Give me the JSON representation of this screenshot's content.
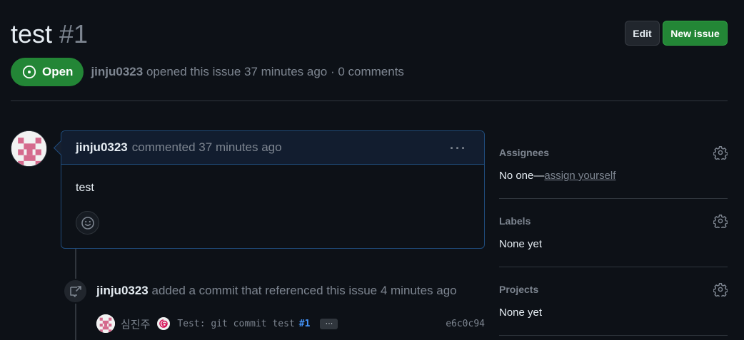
{
  "issue": {
    "title": "test",
    "number": "#1",
    "state": "Open",
    "author": "jinju0323",
    "meta": "opened this issue 37 minutes ago · 0 comments"
  },
  "header_buttons": {
    "edit": "Edit",
    "new_issue": "New issue"
  },
  "comment": {
    "author": "jinju0323",
    "action": "commented 37 minutes ago",
    "menu": "···",
    "body": "test"
  },
  "timeline": {
    "event_author": "jinju0323",
    "event_text": "added a commit that referenced this issue 4 minutes ago",
    "commit": {
      "author": "심진주",
      "message": "Test: git commit test",
      "ref": "#1",
      "ellipsis": "···",
      "sha": "e6c0c94"
    }
  },
  "sidebar": {
    "assignees": {
      "heading": "Assignees",
      "value": "No one—",
      "link": "assign yourself"
    },
    "labels": {
      "heading": "Labels",
      "value": "None yet"
    },
    "projects": {
      "heading": "Projects",
      "value": "None yet"
    }
  },
  "colors": {
    "background": "#0d1117",
    "open_green": "#238636",
    "link_blue": "#4493f8",
    "avatar_pink": "#d56a8d"
  }
}
